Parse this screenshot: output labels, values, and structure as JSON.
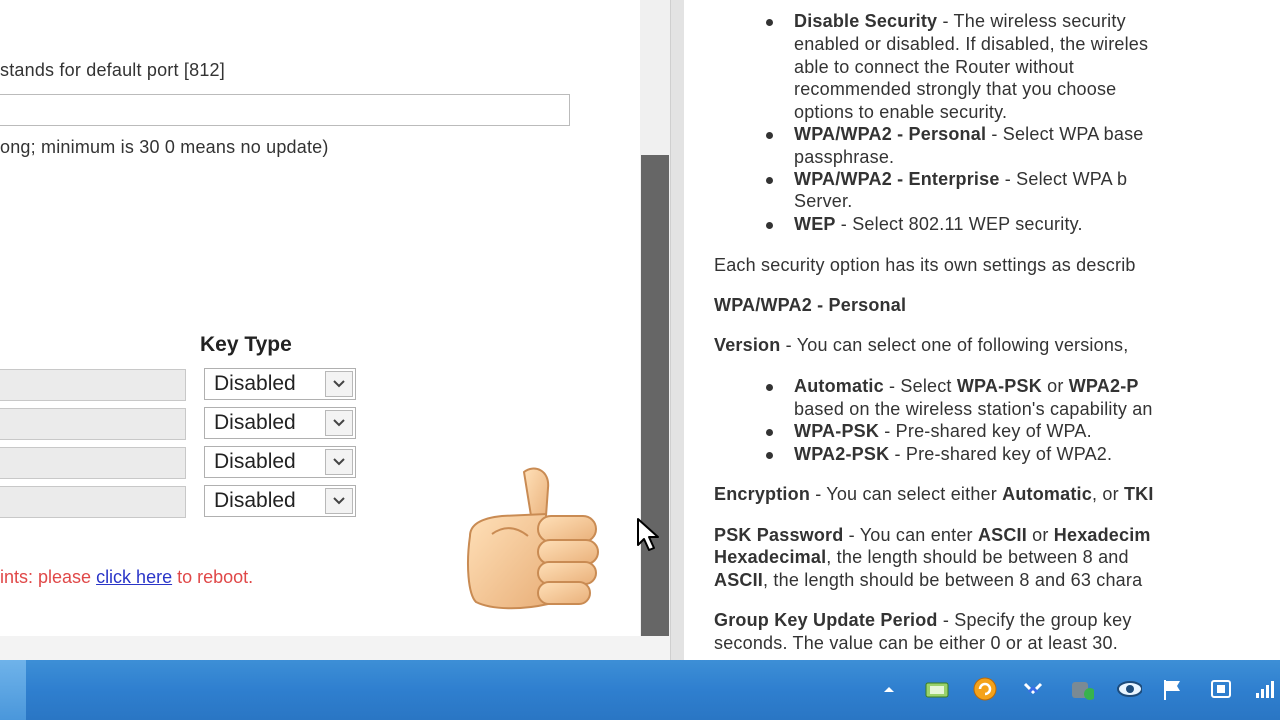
{
  "settings": {
    "port_hint": "stands for default port [812]",
    "url_value": "",
    "period_hint": "ong; minimum is 30  0 means no update)",
    "key_type_header": "Key Type",
    "key_rows": [
      {
        "value": "",
        "key_type": "Disabled"
      },
      {
        "value": "",
        "key_type": "Disabled"
      },
      {
        "value": "",
        "key_type": "Disabled"
      },
      {
        "value": "",
        "key_type": "Disabled"
      }
    ],
    "reboot_prefix": "ints: please ",
    "reboot_link": "click here",
    "reboot_suffix": " to reboot."
  },
  "help": {
    "b1_title": "Disable Security",
    "b1_l1": " - The wireless security",
    "b1_l2": "enabled or disabled. If disabled, the wireles",
    "b1_l3": "able to connect the Router without",
    "b1_l4": "recommended strongly that you choose",
    "b1_l5": "options to enable security.",
    "b2_title": "WPA/WPA2 - Personal",
    "b2_l1": " - Select WPA base",
    "b2_l2": "passphrase.",
    "b3_title": "WPA/WPA2 - Enterprise",
    "b3_l1": " - Select WPA b",
    "b3_l2": "Server.",
    "b4_title": "WEP",
    "b4_l1": " - Select 802.11 WEP security.",
    "p_each": "Each security option has its own settings as describ",
    "h_personal": "WPA/WPA2 - Personal",
    "version_title": "Version",
    "version_text": " -  You can select one of following versions,",
    "v1_title": "Automatic",
    "v1_a": " - Select ",
    "v1_b": "WPA-PSK",
    "v1_c": " or ",
    "v1_d": "WPA2-P",
    "v1_l2": "based on the wireless station's capability an",
    "v2_title": "WPA-PSK",
    "v2_text": " - Pre-shared key of WPA.",
    "v3_title": "WPA2-PSK",
    "v3_text": " - Pre-shared key of WPA2.",
    "enc_title": "Encryption",
    "enc_text": " - You can select either ",
    "enc_auto": "Automatic",
    "enc_or": ", or ",
    "enc_tki": "TKI",
    "psk_title": "PSK Password",
    "psk_a": " - You can enter ",
    "psk_ascii": "ASCII",
    "psk_or": " or ",
    "psk_hex": "Hexadecim",
    "psk_l2_b": "Hexadecimal",
    "psk_l2": ", the length should be between 8 and",
    "psk_l3_b": "ASCII",
    "psk_l3": ", the length should be between 8 and 63 chara",
    "gk_title": "Group Key Update Period",
    "gk_text": " - Specify the group key",
    "gk_l2": "seconds. The value can be either 0 or at least 30."
  },
  "colors": {
    "link": "#2a35c8",
    "reboot_text": "#e04848",
    "taskbar": "#2f7fcf",
    "scroll_thumb": "#666666"
  },
  "icons": [
    "thumbs-up-icon",
    "cursor-icon",
    "chevron-down-icon",
    "show-hidden-icons",
    "network-icon",
    "update-icon",
    "bluetooth-icon",
    "security-icon",
    "eye-icon",
    "flag-icon",
    "device-icon",
    "signal-icon"
  ]
}
